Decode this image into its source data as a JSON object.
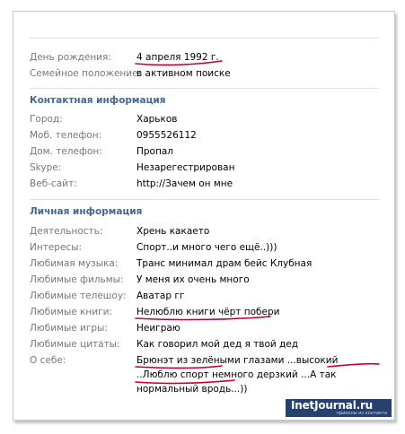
{
  "profile": {
    "birthday_label": "День рождения:",
    "birthday_value": "4 апреля 1992 г.",
    "marital_label": "Семейное положение:",
    "marital_value": "в активном поиске",
    "contact": {
      "title": "Контактная информация",
      "rows": [
        {
          "label": "Город:",
          "value": "Харьков"
        },
        {
          "label": "Моб. телефон:",
          "value": "0955526112"
        },
        {
          "label": "Дом. телефон:",
          "value": "Пропал"
        },
        {
          "label": "Skype:",
          "value": "Незарегестрирован"
        },
        {
          "label": "Веб-сайт:",
          "value": "http://Зачем он мне"
        }
      ]
    },
    "personal": {
      "title": "Личная информация",
      "rows": [
        {
          "label": "Деятельность:",
          "value": "Хрень какаето"
        },
        {
          "label": "Интересы:",
          "value": "Спорт..и много чего ещё..)))"
        },
        {
          "label": "Любимая музыка:",
          "value": "Транс минимал драм бейс Клубная"
        },
        {
          "label": "Любимые фильмы:",
          "value": "У меня их очень много"
        },
        {
          "label": "Любимые телешоу:",
          "value": "Аватар гг"
        },
        {
          "label": "Любимые книги:",
          "value": "Нелюблю книги чёрт побери"
        },
        {
          "label": "Любимые игры:",
          "value": "Неиграю"
        },
        {
          "label": "Любимые цитаты:",
          "value": "Как говорил мой дед я твой дед"
        }
      ],
      "about_label": "О себе:",
      "about_value": "Брюнэт из зелёными глазами ...высокий ..Люблю спорт немного дерзкий ...А так нормальный вродь...))"
    }
  },
  "watermark": {
    "title": "InetJournal.ru",
    "subtitle": "приколы из контакта"
  },
  "colors": {
    "section_title": "#45688e",
    "label": "#777777",
    "divider": "#dae1e8",
    "ink_underline": "#c0002a",
    "watermark_bg": "#27416d"
  }
}
